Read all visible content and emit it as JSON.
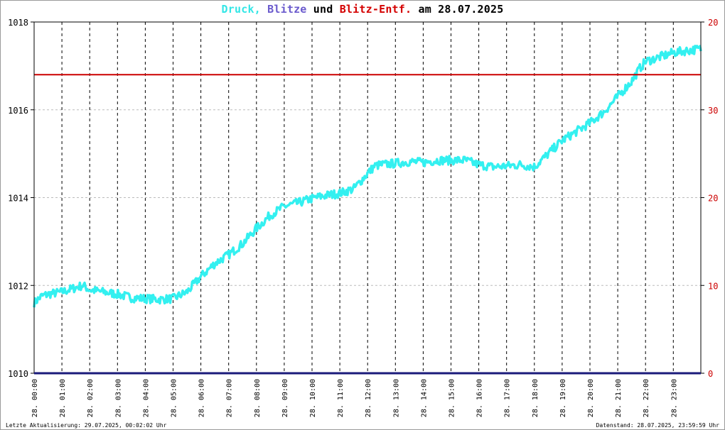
{
  "title": {
    "druck": "Druck,",
    "blitze": "Blitze",
    "und": "und",
    "blitz_entf": "Blitz-Entf.",
    "date": "am 28.07.2025"
  },
  "footer": {
    "left": "Letzte Aktualisierung: 29.07.2025, 00:02:02 Uhr",
    "right": "Datenstand: 28.07.2025, 23:59:59 Uhr"
  },
  "colors": {
    "pressure": "#33f0f0",
    "lightning": "#1a1a7a",
    "distance": "#cc0000",
    "right_axis": "#cc0000",
    "grid_h": "#bbbbbb",
    "grid_v": "#000000"
  },
  "chart_data": {
    "type": "line",
    "x_ticks": [
      "28. 00:00",
      "28. 01:00",
      "28. 02:00",
      "28. 03:00",
      "28. 04:00",
      "28. 05:00",
      "28. 06:00",
      "28. 07:00",
      "28. 08:00",
      "28. 09:00",
      "28. 10:00",
      "28. 11:00",
      "28. 12:00",
      "28. 13:00",
      "28. 14:00",
      "28. 15:00",
      "28. 16:00",
      "28. 17:00",
      "28. 18:00",
      "28. 19:00",
      "28. 20:00",
      "28. 21:00",
      "28. 22:00",
      "28. 23:00"
    ],
    "x_range_hours": [
      0,
      23.99
    ],
    "left_axis": {
      "range": [
        1010,
        1018
      ],
      "ticks": [
        "1010",
        "1012",
        "1014",
        "1016",
        "1018"
      ]
    },
    "right_axis": {
      "range": [
        0,
        20
      ],
      "ticks": [
        "0",
        "10",
        "20",
        "30",
        "20"
      ]
    },
    "grid": true,
    "series": [
      {
        "name": "Druck",
        "axis": "left",
        "x_hours": [
          0,
          0.25,
          0.5,
          1,
          1.5,
          1.75,
          2,
          2.5,
          3,
          3.5,
          4,
          4.5,
          5,
          5.5,
          6,
          6.5,
          7,
          7.5,
          8,
          8.5,
          9,
          9.5,
          10,
          10.5,
          11,
          11.5,
          12,
          12.25,
          12.5,
          13,
          13.5,
          14,
          14.5,
          15,
          15.5,
          16,
          16.5,
          17,
          17.5,
          18,
          18.5,
          19,
          19.5,
          20,
          20.5,
          21,
          21.5,
          21.8,
          22,
          22.5,
          23,
          23.5,
          23.9
        ],
        "values": [
          1011.6,
          1011.75,
          1011.8,
          1011.85,
          1011.95,
          1012.0,
          1011.9,
          1011.85,
          1011.8,
          1011.72,
          1011.7,
          1011.68,
          1011.7,
          1011.85,
          1012.2,
          1012.5,
          1012.7,
          1012.95,
          1013.3,
          1013.6,
          1013.8,
          1013.88,
          1013.98,
          1014.05,
          1014.1,
          1014.2,
          1014.55,
          1014.72,
          1014.75,
          1014.78,
          1014.82,
          1014.8,
          1014.85,
          1014.85,
          1014.85,
          1014.75,
          1014.7,
          1014.72,
          1014.75,
          1014.7,
          1015.0,
          1015.3,
          1015.5,
          1015.7,
          1015.95,
          1016.3,
          1016.65,
          1016.95,
          1017.1,
          1017.2,
          1017.3,
          1017.35,
          1017.38
        ],
        "noise": 0.1
      },
      {
        "name": "Blitz-Entf.",
        "axis": "left",
        "x_hours": [
          0,
          23.99
        ],
        "values": [
          1016.8,
          1016.8
        ]
      },
      {
        "name": "Blitze",
        "axis": "right",
        "x_hours": [
          0,
          23.99
        ],
        "values": [
          0,
          0
        ]
      }
    ]
  }
}
